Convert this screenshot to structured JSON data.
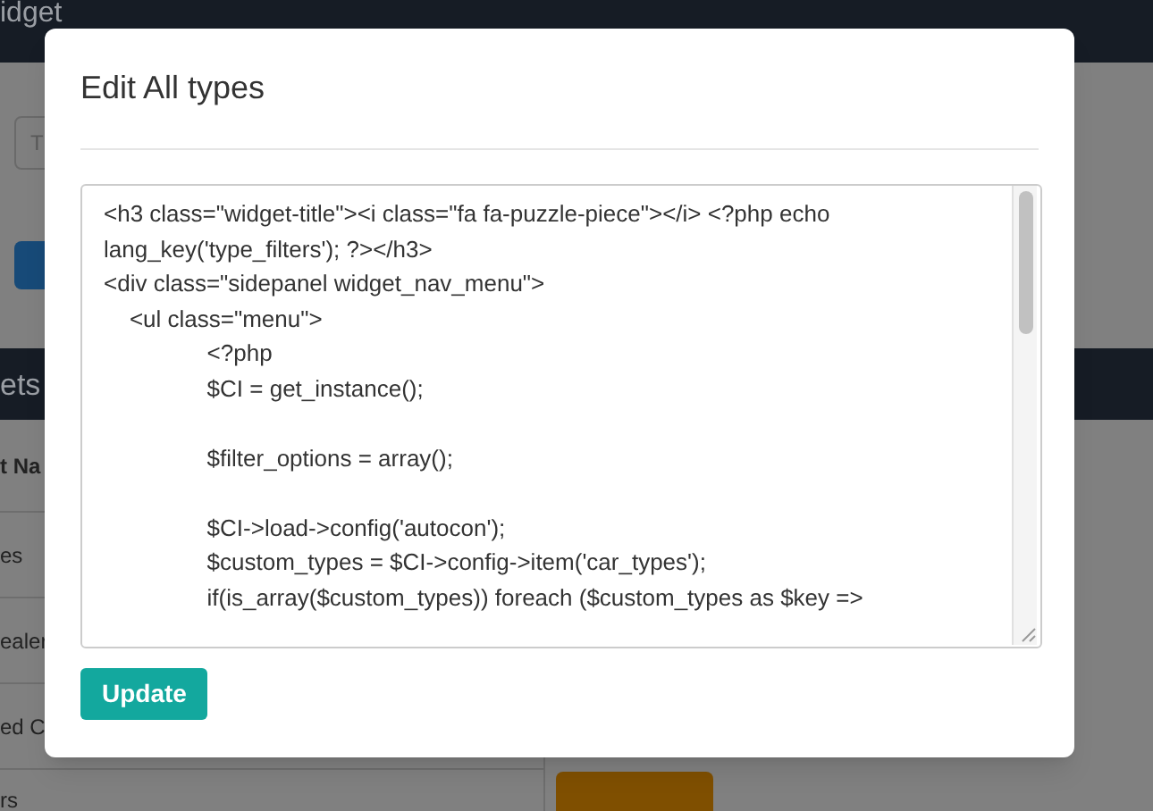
{
  "background": {
    "header_title": "idget",
    "search": {
      "placeholder": "T"
    },
    "section_title": "ets",
    "table": {
      "column_1": "t Na",
      "rows": [
        "es",
        "ealer",
        "ed C",
        "rs"
      ]
    }
  },
  "modal": {
    "title": "Edit All types",
    "code": "<h3 class=\"widget-title\"><i class=\"fa fa-puzzle-piece\"></i> <?php echo lang_key('type_filters'); ?></h3>\n<div class=\"sidepanel widget_nav_menu\">\n    <ul class=\"menu\">\n                <?php\n                $CI = get_instance();\n\n                $filter_options = array();\n\n                $CI->load->config('autocon');\n                $custom_types = $CI->config->item('car_types');\n                if(is_array($custom_types)) foreach ($custom_types as $key =>",
    "button": "Update"
  }
}
